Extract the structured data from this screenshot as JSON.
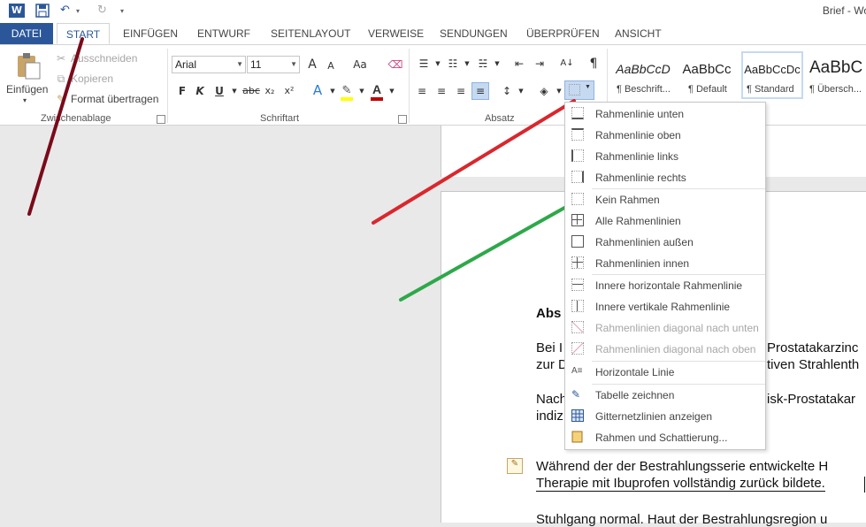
{
  "window": {
    "title": "Brief - Wo"
  },
  "tabs": [
    {
      "label": "DATEI"
    },
    {
      "label": "START"
    },
    {
      "label": "EINFÜGEN"
    },
    {
      "label": "ENTWURF"
    },
    {
      "label": "SEITENLAYOUT"
    },
    {
      "label": "VERWEISE"
    },
    {
      "label": "SENDUNGEN"
    },
    {
      "label": "ÜBERPRÜFEN"
    },
    {
      "label": "ANSICHT"
    }
  ],
  "clipboard": {
    "paste": "Einfügen",
    "cut": "Ausschneiden",
    "copy": "Kopieren",
    "format_painter": "Format übertragen",
    "group_label": "Zwischenablage"
  },
  "font": {
    "name": "Arial",
    "size": "11",
    "bold": "F",
    "italic": "K",
    "underline": "U",
    "strike": "abc",
    "subscript": "x₂",
    "superscript": "x²",
    "grow": "A",
    "shrink": "A",
    "case": "Aa",
    "group_label": "Schriftart",
    "highlight_color": "#ffff00",
    "font_color": "#c00000"
  },
  "paragraph": {
    "group_label": "Absatz",
    "pilcrow": "¶",
    "sort": "A↓"
  },
  "styles": [
    {
      "sample": "AaBbCcD",
      "name": "¶ Beschrift..."
    },
    {
      "sample": "AaBbCc",
      "name": "¶ Default"
    },
    {
      "sample": "AaBbCcDc",
      "name": "¶ Standard"
    },
    {
      "sample": "AaBbC",
      "name": "¶ Übersch..."
    }
  ],
  "border_menu": [
    {
      "label": "Rahmenlinie unten",
      "enabled": true
    },
    {
      "label": "Rahmenlinie oben",
      "enabled": true
    },
    {
      "label": "Rahmenlinie links",
      "enabled": true
    },
    {
      "label": "Rahmenlinie rechts",
      "enabled": true
    },
    {
      "label": "Kein Rahmen",
      "enabled": true
    },
    {
      "label": "Alle Rahmenlinien",
      "enabled": true
    },
    {
      "label": "Rahmenlinien außen",
      "enabled": true
    },
    {
      "label": "Rahmenlinien innen",
      "enabled": true
    },
    {
      "label": "Innere horizontale Rahmenlinie",
      "enabled": true
    },
    {
      "label": "Innere vertikale Rahmenlinie",
      "enabled": true
    },
    {
      "label": "Rahmenlinien diagonal nach unten",
      "enabled": false
    },
    {
      "label": "Rahmenlinien diagonal nach oben",
      "enabled": false
    },
    {
      "label": "Horizontale Linie",
      "enabled": true
    },
    {
      "label": "Tabelle zeichnen",
      "enabled": true
    },
    {
      "label": "Gitternetzlinien anzeigen",
      "enabled": true
    },
    {
      "label": "Rahmen und Schattierung...",
      "enabled": true
    }
  ],
  "document": {
    "heading": "Abs",
    "p1_line1_left": "Bei I",
    "p1_line1_right": "Prostatakarzinc",
    "p1_line2_left": "zur D",
    "p1_line2_right": "tiven Strahlenth",
    "p2_line1_left": "Nach",
    "p2_line1_right": "isk-Prostatakar",
    "p2_line2_left": "indiz",
    "p3_line1": "Während der der Bestrahlungsserie entwickelte H",
    "p3_line2": "Therapie mit Ibuprofen vollständig zurück bildete.",
    "p4_line1": "Stuhlgang normal. Haut der Bestrahlungsregion u"
  },
  "annotations": {
    "dark_red": "#7a0a1a",
    "red": "#d9272e",
    "green": "#2ea84a"
  }
}
